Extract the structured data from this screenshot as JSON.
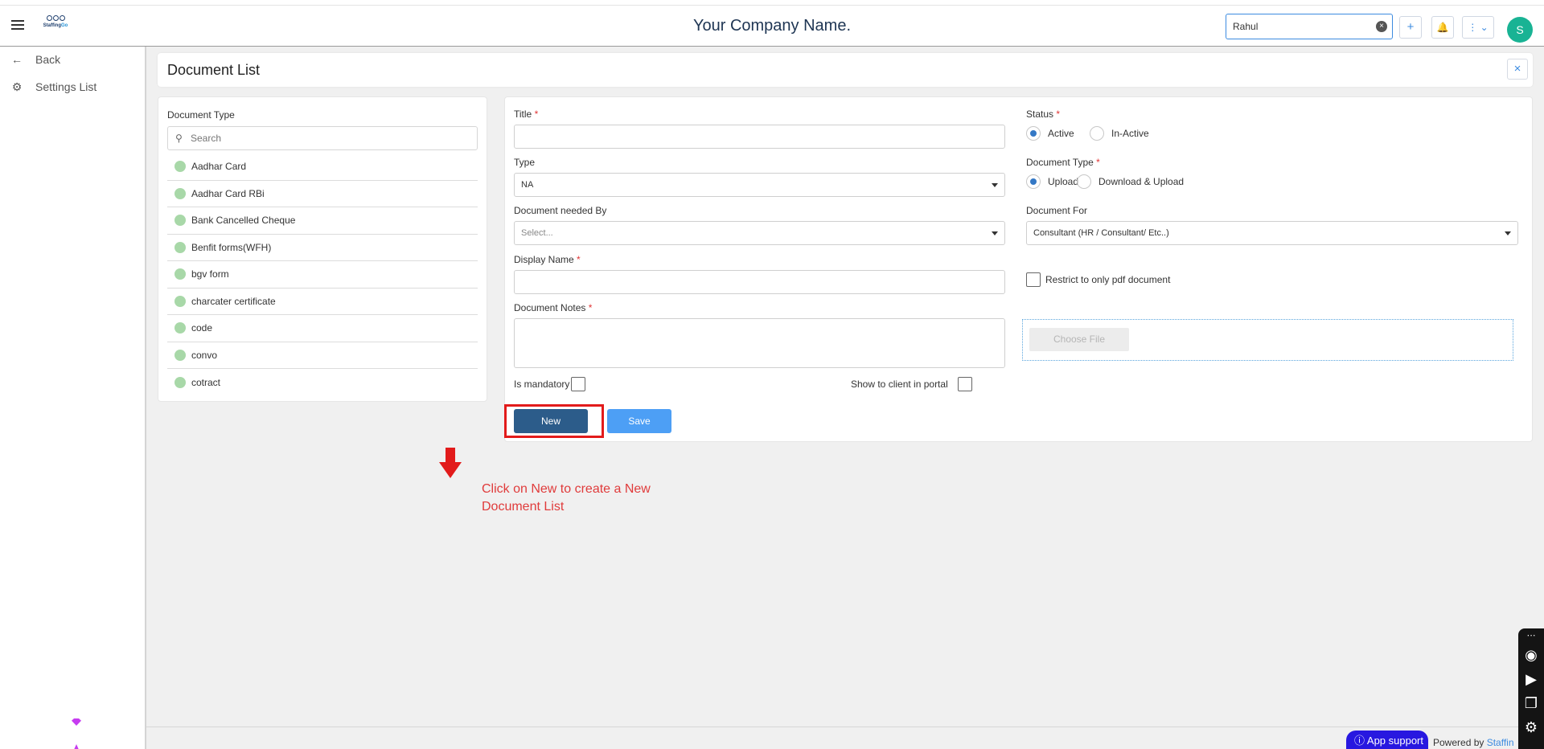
{
  "topbar": {
    "logo_text_a": "Staffing",
    "logo_text_b": "Go",
    "company_name": "Your Company Name.",
    "search_value": "Rahul",
    "clear_glyph": "×",
    "add_glyph": "+",
    "bell_glyph": "🔔",
    "more_glyph": "⋮ ⌄",
    "avatar_initial": "S"
  },
  "sidebar": {
    "back_label": "Back",
    "settings_label": "Settings List"
  },
  "header": {
    "title": "Document List",
    "close_glyph": "×"
  },
  "doc_list": {
    "label": "Document Type",
    "search_placeholder": "Search",
    "items": [
      "Aadhar Card",
      "Aadhar Card RBi",
      "Bank Cancelled Cheque",
      "Benfit forms(WFH)",
      "bgv form",
      "charcater certificate",
      "code",
      "convo",
      "cotract"
    ]
  },
  "form": {
    "title_label": "Title",
    "type_label": "Type",
    "type_value": "NA",
    "needed_by_label": "Document needed By",
    "needed_by_placeholder": "Select...",
    "display_name_label": "Display Name",
    "notes_label": "Document Notes",
    "mandatory_label": "Is mandatory",
    "show_client_label": "Show to client in portal",
    "status_label": "Status",
    "status_active": "Active",
    "status_inactive": "In-Active",
    "doc_type_label": "Document Type",
    "doc_type_upload": "Upload",
    "doc_type_download": "Download & Upload",
    "doc_for_label": "Document For",
    "doc_for_value": "Consultant (HR / Consultant/ Etc..)",
    "restrict_label": "Restrict to only pdf document",
    "choose_file": "Choose File",
    "required_mark": "*",
    "new_button": "New",
    "save_button": "Save"
  },
  "annotation": {
    "note": "Click on New to create a New Document List",
    "highlight_color": "#e21b1b"
  },
  "footer": {
    "app_support": "ⓘ App support",
    "powered_by": "Powered by",
    "brand": "Staffin"
  },
  "colors": {
    "primary_dark": "#2c5c8a",
    "primary": "#4d9ff5",
    "avatar": "#19b394"
  }
}
